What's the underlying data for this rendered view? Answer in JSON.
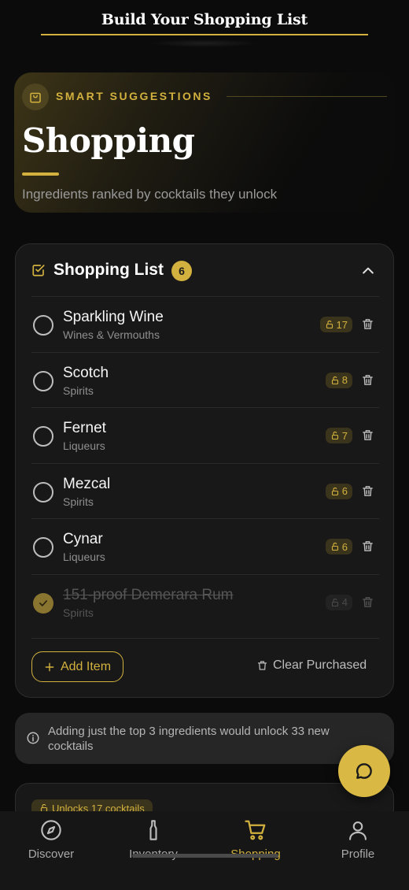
{
  "header": {
    "title": "Build Your Shopping List"
  },
  "hero": {
    "eyebrow": "SMART SUGGESTIONS",
    "title": "Shopping",
    "subtitle": "Ingredients ranked by cocktails they unlock"
  },
  "shopping_list": {
    "title": "Shopping List",
    "count": "6",
    "items": [
      {
        "name": "Sparkling Wine",
        "category": "Wines & Vermouths",
        "unlocks": "17",
        "purchased": false
      },
      {
        "name": "Scotch",
        "category": "Spirits",
        "unlocks": "8",
        "purchased": false
      },
      {
        "name": "Fernet",
        "category": "Liqueurs",
        "unlocks": "7",
        "purchased": false
      },
      {
        "name": "Mezcal",
        "category": "Spirits",
        "unlocks": "6",
        "purchased": false
      },
      {
        "name": "Cynar",
        "category": "Liqueurs",
        "unlocks": "6",
        "purchased": false
      },
      {
        "name": "151-proof Demerara Rum",
        "category": "Spirits",
        "unlocks": "4",
        "purchased": true
      }
    ],
    "add_label": "Add Item",
    "clear_label": "Clear Purchased"
  },
  "tip": {
    "text": "Adding just the top 3 ingredients would unlock 33 new cocktails"
  },
  "peek": {
    "chip": "Unlocks 17 cocktails"
  },
  "tabs": [
    {
      "label": "Discover",
      "icon": "compass-icon",
      "active": false
    },
    {
      "label": "Inventory",
      "icon": "bottle-icon",
      "active": false
    },
    {
      "label": "Shopping",
      "icon": "cart-icon",
      "active": true
    },
    {
      "label": "Profile",
      "icon": "user-icon",
      "active": false
    }
  ],
  "colors": {
    "accent": "#d2b13e",
    "background": "#0b0b0b",
    "card": "#181818"
  }
}
